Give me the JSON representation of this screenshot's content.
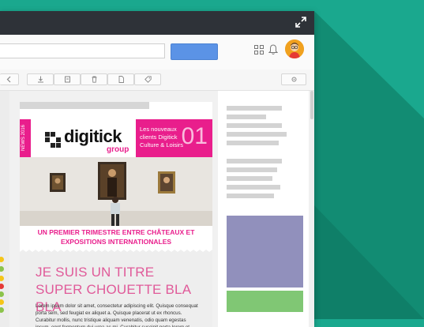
{
  "colors": {
    "background": "#1aa88e",
    "titlebar": "#2e3238",
    "accent_pink": "#e91e8c",
    "purple_block": "#9190bc",
    "green_block": "#80c774",
    "search_button": "#5b93e6"
  },
  "titlebar": {
    "expand_icon": "expand-icon"
  },
  "topbar": {
    "apps_icon": "apps-grid-icon",
    "bell_icon": "bell-icon",
    "avatar_icon": "user-avatar"
  },
  "toolbar": {
    "buttons": [
      "chevron-left-icon",
      "download-icon",
      "archive-icon",
      "trash-icon",
      "document-icon",
      "tag-icon",
      "settings-icon"
    ]
  },
  "email": {
    "brand_name": "digitick",
    "brand_sub": "group",
    "news_label": "NEWS 2016",
    "pink_text": "Les nouveaux clients Digitick Culture & Loisirs",
    "pink_number": "01",
    "headline": "UN PREMIER TRIMESTRE ENTRE CHÂTEAUX ET EXPOSITIONS INTERNATIONALES",
    "big_title": "JE SUIS UN TITRE SUPER CHOUETTE BLA BLA",
    "body_text": "Lorem ipsum dolor sit amet, consectetur adipiscing elit. Quisque consequat porta sem, sed feugiat ex aliquet a. Quisque placerat ut ex rhoncus. Curabitur mollis, nunc tristique aliquam venenatis, odio quam egestas ipsum, eget fermentum dui urna ac mi. Curabitur suscipit porta lorem et volutpat nec consectetur. Duis tempor augue libero"
  }
}
